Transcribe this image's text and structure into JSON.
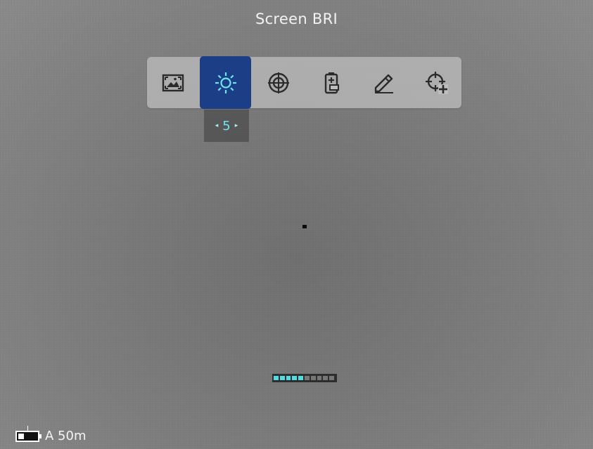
{
  "header": {
    "title": "Screen BRI"
  },
  "menu": {
    "items": [
      {
        "id": "image-mode",
        "icon": "image-frame-icon",
        "active": false
      },
      {
        "id": "brightness",
        "icon": "sun-brightness-icon",
        "active": true
      },
      {
        "id": "reticle",
        "icon": "target-reticle-icon",
        "active": false
      },
      {
        "id": "battery-settings",
        "icon": "battery-settings-icon",
        "active": false
      },
      {
        "id": "measure",
        "icon": "ruler-pencil-icon",
        "active": false
      },
      {
        "id": "add-zero",
        "icon": "crosshair-plus-icon",
        "active": false
      }
    ],
    "active_color": "#1c3e86",
    "bar_color": "#bebebe"
  },
  "brightness_value": {
    "value": "5",
    "left_arrow": "◂",
    "right_arrow": "▸"
  },
  "level_indicator": {
    "segments_total": 10,
    "segments_filled": 5,
    "filled_color": "#53dce4"
  },
  "status": {
    "battery_icon": "battery-icon",
    "battery_level_fraction": 0.3,
    "mode_label": "A 50m"
  }
}
